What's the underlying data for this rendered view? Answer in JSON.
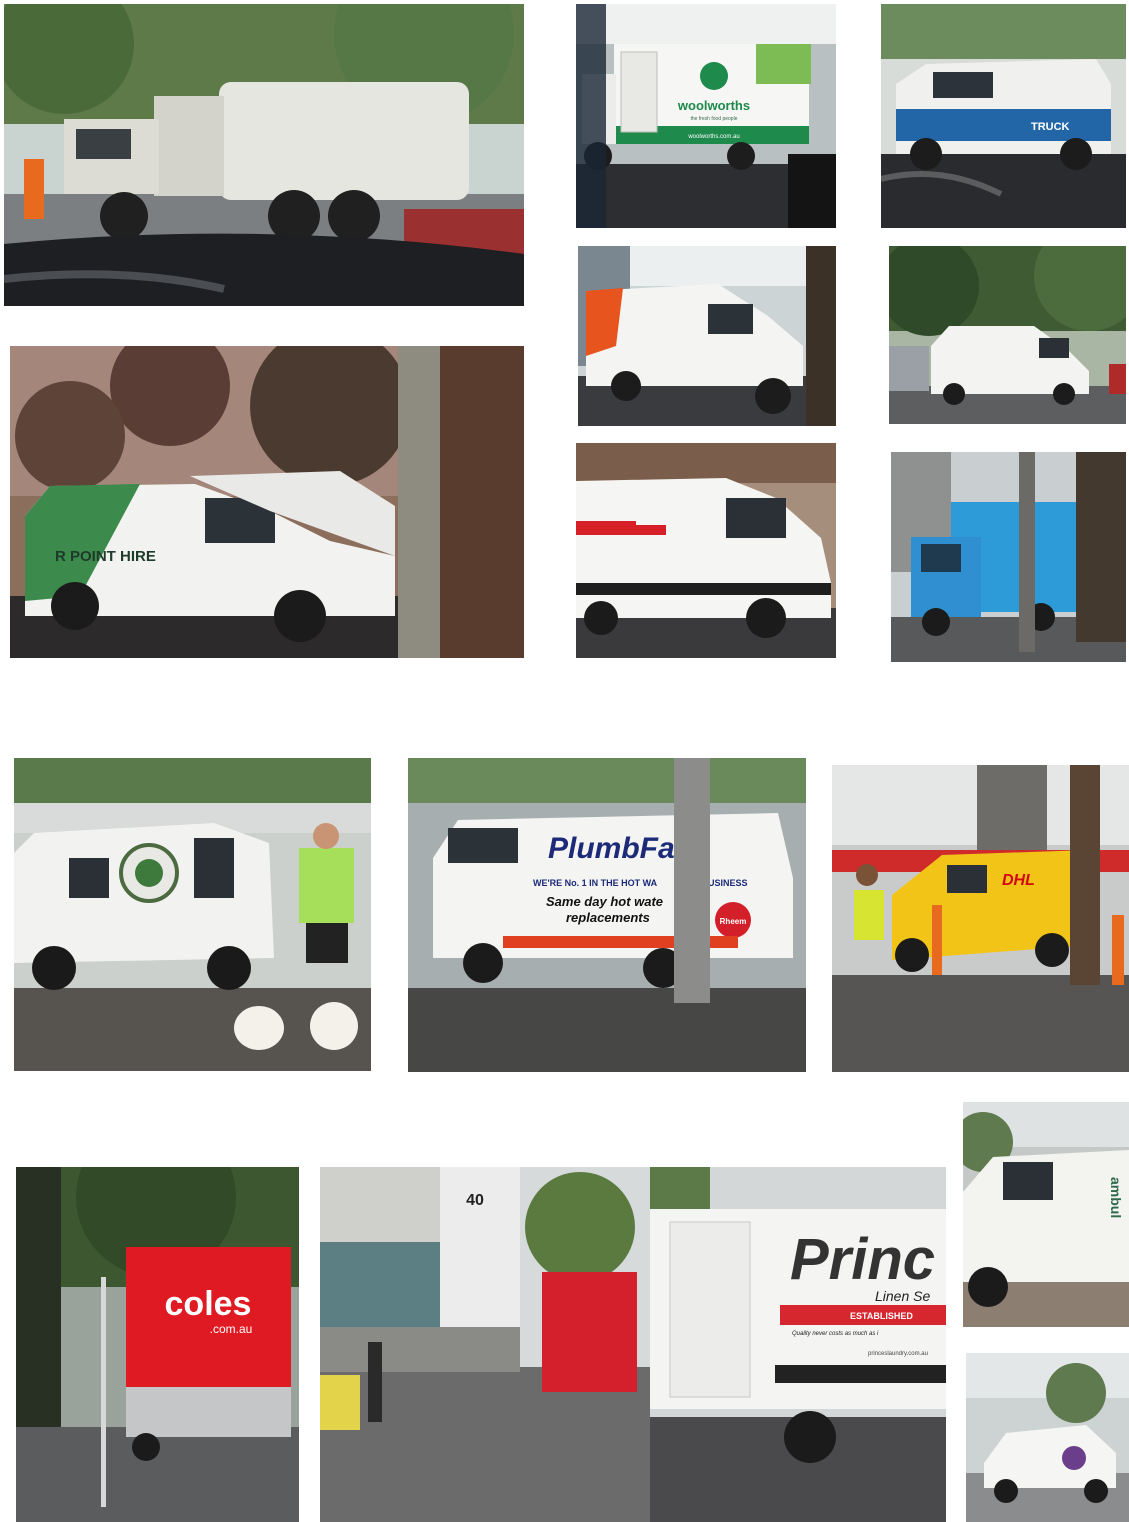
{
  "photos": {
    "garbage_truck": {},
    "woolworths": {
      "brand": "woolworths",
      "tagline": "the fresh food people",
      "url": "woolworths.com.au"
    },
    "blue_van": {
      "brand": "TRUCK"
    },
    "orange_van": {},
    "small_van_top": {},
    "power_hire": {
      "brand": "R POINT HIRE"
    },
    "red_stripe_van": {},
    "blue_truck": {},
    "dog_van": {},
    "plumbfast": {
      "brand": "PlumbFast",
      "line1": "WE'RE No. 1 IN THE HOT WA",
      "line2": "USINESS",
      "line3": "Same day hot wate",
      "line4": "replacements",
      "badge": "Rheem"
    },
    "dhl": {
      "brand": "DHL"
    },
    "ambulance_van": {
      "brand": "ambul"
    },
    "coles": {
      "brand": "coles",
      "sub": ".com.au"
    },
    "building": {
      "number": "40"
    },
    "princes": {
      "brand": "Princ",
      "sub": "Linen Se",
      "band": "ESTABLISHED",
      "quote": "Quality never costs as much as i",
      "url": "princeslaundry.com.au"
    },
    "small_car": {}
  },
  "colors": {
    "sky": "#e7ecee",
    "tree": "#3f5a32",
    "road": "#3c3d40",
    "van": "#f2f2f0",
    "woolworths_green": "#1e8a4c",
    "dhl_yellow": "#f2c418",
    "dhl_red": "#d40511",
    "coles_red": "#e01a22",
    "plumb_blue": "#1c2a78",
    "princes_red": "#d6262e"
  }
}
